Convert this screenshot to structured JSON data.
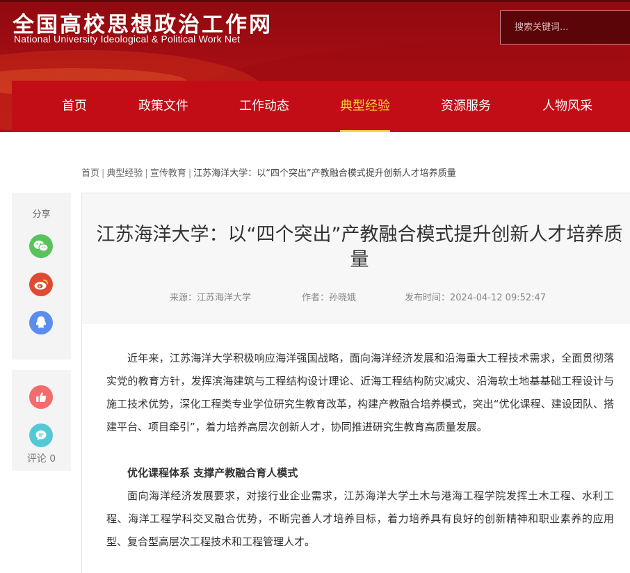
{
  "header": {
    "logo_cn": "全国高校思想政治工作网",
    "logo_en": "National University Ideological & Political Work Net",
    "search_placeholder": "搜索关键词..."
  },
  "nav": {
    "items": [
      {
        "label": "首页"
      },
      {
        "label": "政策文件"
      },
      {
        "label": "工作动态"
      },
      {
        "label": "典型经验",
        "active": true
      },
      {
        "label": "资源服务"
      },
      {
        "label": "人物风采"
      }
    ],
    "active_color": "#ffd23c"
  },
  "breadcrumb": {
    "items": [
      "首页",
      "典型经验",
      "宣传教育",
      "江苏海洋大学：以“四个突出”产教融合模式提升创新人才培养质量"
    ]
  },
  "share": {
    "label": "分享",
    "icons": [
      "wechat-icon",
      "weibo-icon",
      "qq-icon"
    ],
    "like_icon": "thumbs-up-icon",
    "comment_icon": "comment-icon",
    "comment_label": "评论 0"
  },
  "article": {
    "title": "江苏海洋大学：以“四个突出”产教融合模式提升创新人才培养质量",
    "source": "来源：江苏海洋大学",
    "author": "作者：孙晓娥",
    "published": "发布时间：2024-04-12 09:52:47",
    "paragraphs": [
      "近年来，江苏海洋大学积极响应海洋强国战略，面向海洋经济发展和沿海重大工程技术需求，全面贯彻落实党的教育方针，发挥滨海建筑与工程结构设计理论、近海工程结构防灾减灾、沿海软土地基基础工程设计与施工技术优势，深化工程类专业学位研究生教育改革，构建产教融合培养模式，突出“优化课程、建设团队、搭建平台、项目牵引”，着力培养高层次创新人才，协同推进研究生教育高质量发展。"
    ],
    "subheading": "优化课程体系 支撑产教融合育人模式",
    "paragraph2": "面向海洋经济发展要求，对接行业企业需求，江苏海洋大学土木与港海工程学院发挥土木工程、水利工程、海洋工程学科交叉融合优势，不断完善人才培养目标，着力培养具有良好的创新精神和职业素养的应用型、复合型高层次工程技术和工程管理人才。"
  },
  "colors": {
    "brand_red": "#c20d16",
    "header_dark": "#8f0a0f",
    "accent_yellow": "#ffd23c"
  }
}
